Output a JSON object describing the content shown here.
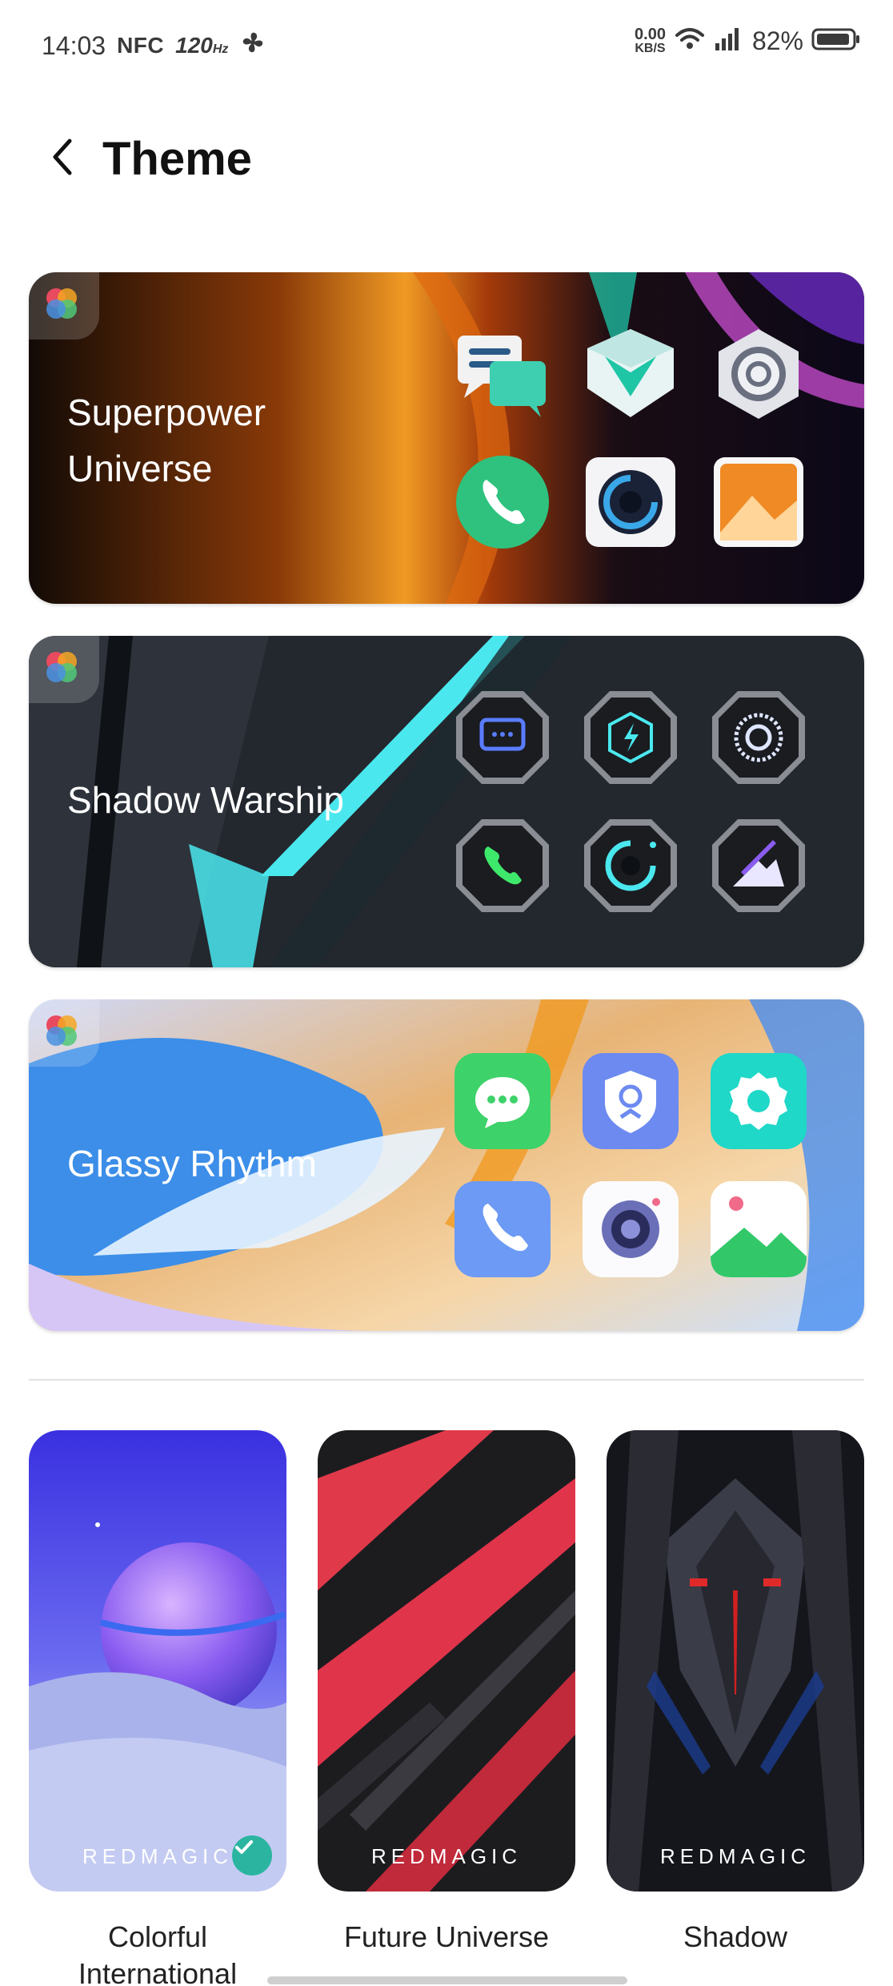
{
  "status_bar": {
    "time": "14:03",
    "nfc": "NFC",
    "refresh_rate": "120",
    "refresh_unit": "Hz",
    "net_speed_value": "0.00",
    "net_speed_unit": "KB/S",
    "battery_percent": "82%",
    "icons": [
      "fan-icon",
      "wifi-icon",
      "signal-icon",
      "battery-icon"
    ]
  },
  "header": {
    "back_icon": "chevron-left-icon",
    "title": "Theme"
  },
  "themes": [
    {
      "name_line1": "Superpower",
      "name_line2": "Universe",
      "badge_icon": "color-wheel-icon",
      "icons": [
        "messages-icon",
        "security-icon",
        "settings-icon",
        "phone-icon",
        "camera-icon",
        "gallery-icon"
      ]
    },
    {
      "name": "Shadow Warship",
      "badge_icon": "color-wheel-icon",
      "icons": [
        "messages-icon",
        "bolt-icon",
        "settings-icon",
        "phone-icon",
        "camera-icon",
        "gallery-icon"
      ]
    },
    {
      "name": "Glassy Rhythm",
      "badge_icon": "color-wheel-icon",
      "icons": [
        "messages-icon",
        "security-icon",
        "settings-icon",
        "phone-icon",
        "camera-icon",
        "gallery-icon"
      ]
    }
  ],
  "wallpapers": [
    {
      "brand": "REDMAGIC",
      "label_line1": "Colorful",
      "label_line2": "International",
      "selected": true
    },
    {
      "brand": "REDMAGIC",
      "label": "Future Universe",
      "selected": false
    },
    {
      "brand": "REDMAGIC",
      "label": "Shadow",
      "selected": false
    }
  ],
  "colors": {
    "accent_check": "#2bb5a0",
    "title_text": "#111111"
  }
}
